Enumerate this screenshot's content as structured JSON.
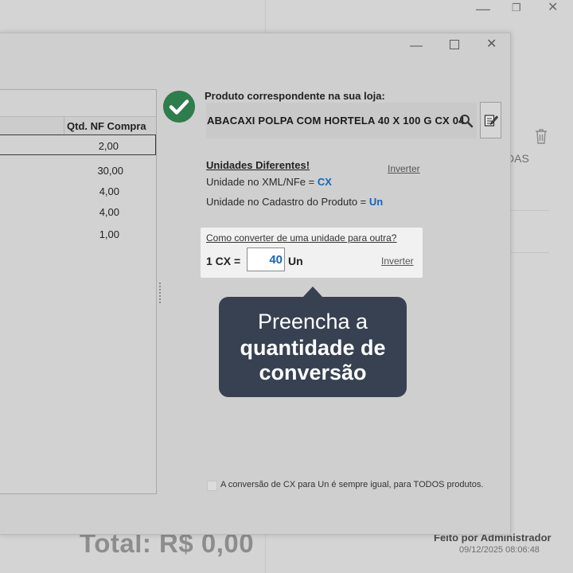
{
  "background": {
    "das_text": "DAS",
    "total_text": "Total:  R$ 0,00",
    "feito_por": "Feito por Administrador",
    "datetime": "09/12/2025 08:06:48"
  },
  "table": {
    "column_header": "Qtd. NF Compra",
    "rows": [
      "2,00",
      "30,00",
      "4,00",
      "4,00",
      "1,00"
    ]
  },
  "product": {
    "label": "Produto correspondente na sua loja:",
    "name": "ABACAXI POLPA COM HORTELA 40 X 100 G CX 04"
  },
  "units": {
    "title": "Unidades Diferentes!",
    "invert_label": "Inverter",
    "xml_label": "Unidade no XML/NFe = ",
    "xml_unit": "CX",
    "cadastro_label": "Unidade no Cadastro do Produto = ",
    "cadastro_unit": "Un"
  },
  "conversion": {
    "question": "Como converter de uma unidade para outra?",
    "prefix": "1 CX =",
    "value": "40",
    "unit": "Un",
    "invert_label": "Inverter"
  },
  "tooltip": {
    "line1": "Preencha a",
    "line2": "quantidade de",
    "line3": "conversão"
  },
  "footer": {
    "checkbox_label": "A conversão de CX para Un é sempre igual, para TODOS produtos.",
    "checkbox_checked": false
  },
  "colors": {
    "accent_blue": "#1565c0",
    "tooltip_bg": "#374151",
    "check_green": "#2e7d4c"
  }
}
